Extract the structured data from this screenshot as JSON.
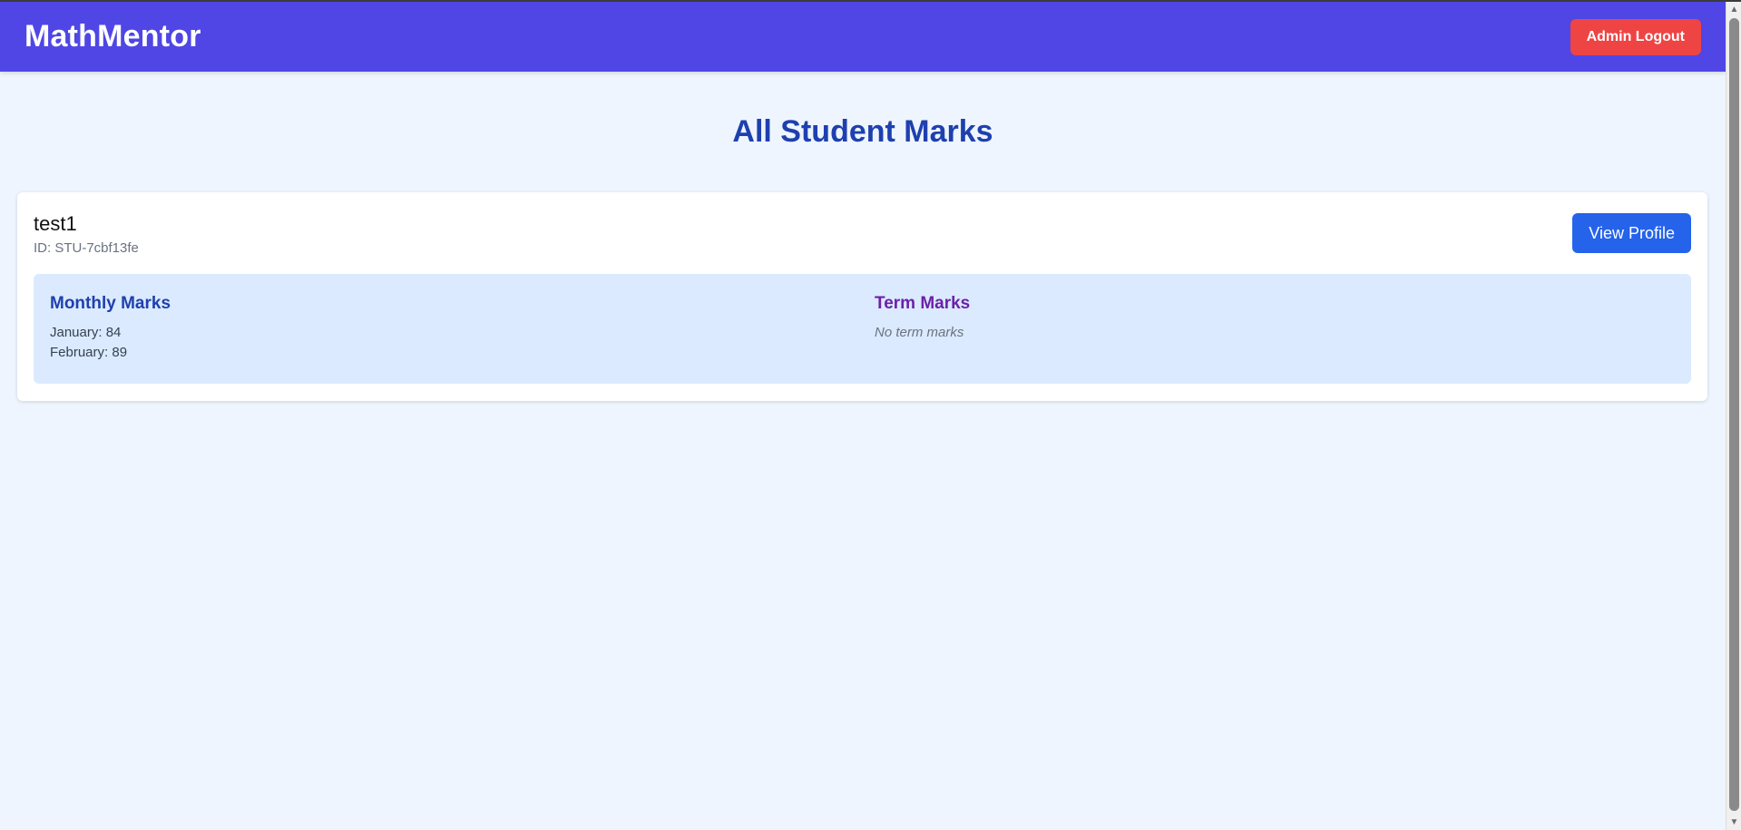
{
  "header": {
    "brand": "MathMentor",
    "logout_label": "Admin Logout"
  },
  "page": {
    "title": "All Student Marks"
  },
  "students": [
    {
      "name": "test1",
      "id_text": "ID: STU-7cbf13fe",
      "view_profile_label": "View Profile",
      "monthly": {
        "heading": "Monthly Marks",
        "marks": [
          "January: 84",
          "February: 89"
        ]
      },
      "term": {
        "heading": "Term Marks",
        "empty_text": "No term marks"
      }
    }
  ],
  "colors": {
    "navbar": "#4f46e5",
    "logout": "#ef4444",
    "primary_button": "#2563eb",
    "title": "#1e40af",
    "term_heading": "#6b21a8",
    "panel": "#dbeafe",
    "background": "#eef5fe"
  },
  "icons": {
    "scroll_up": "triangle-up",
    "scroll_down": "triangle-down"
  }
}
